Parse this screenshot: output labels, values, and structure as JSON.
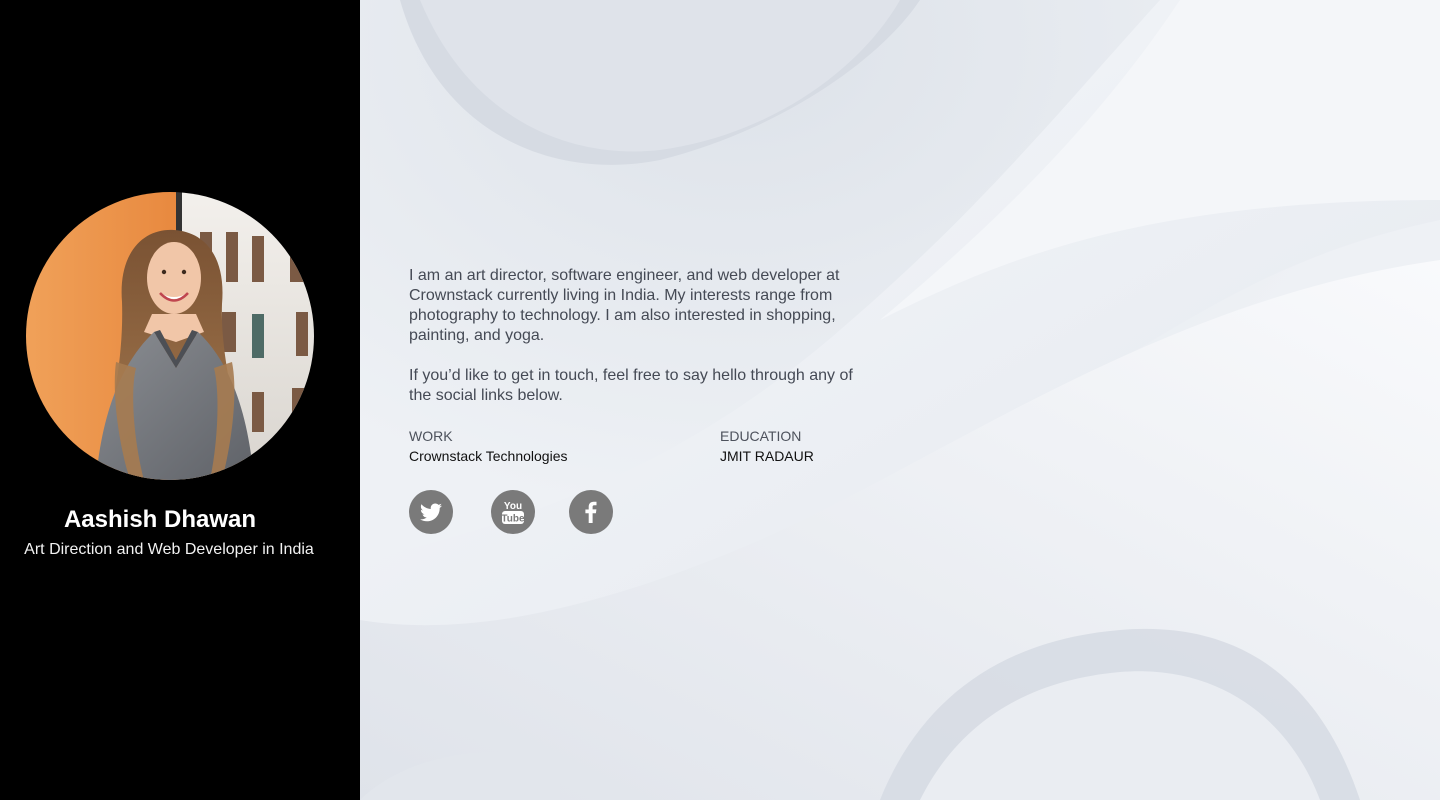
{
  "profile": {
    "name": "Aashish Dhawan",
    "tagline": "Art Direction and Web Developer in India"
  },
  "bio": {
    "paragraph1": "I am an art director, software engineer, and web developer at Crownstack currently living in India. My interests range from photography to technology. I am also interested in shopping, painting, and yoga.",
    "paragraph2": "If you’d like to get in touch, feel free to say hello through any of the social links below."
  },
  "work": {
    "label": "WORK",
    "value": "Crownstack Technologies"
  },
  "education": {
    "label": "EDUCATION",
    "value": "JMIT RADAUR"
  },
  "social": [
    {
      "icon": "twitter-icon"
    },
    {
      "icon": "youtube-icon",
      "text": "You Tube"
    },
    {
      "icon": "facebook-icon",
      "text": "f"
    }
  ],
  "colors": {
    "sidebar": "#000000",
    "social_button": "#7a7a7a",
    "body_text": "#454a55"
  }
}
